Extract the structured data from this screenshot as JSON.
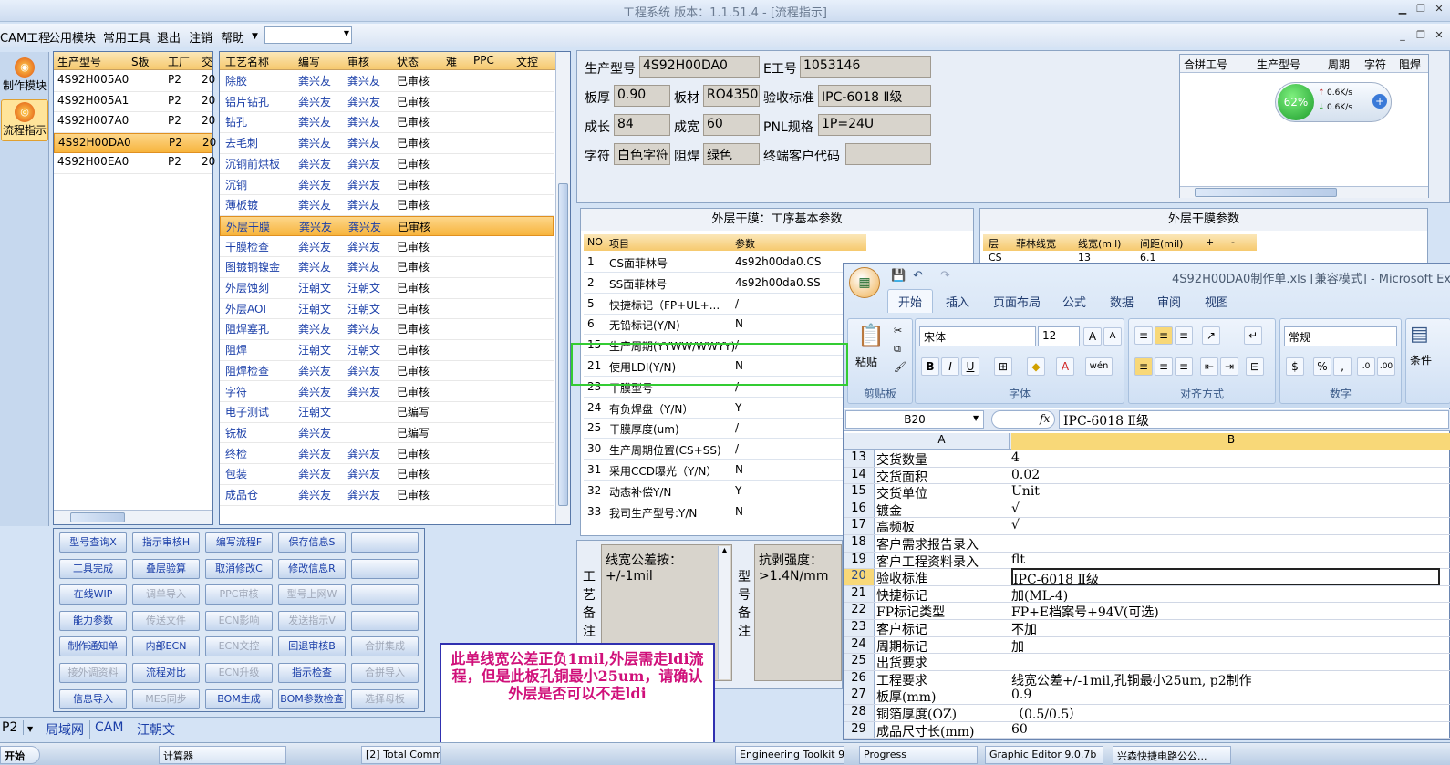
{
  "title": "工程系统   版本：1.1.51.4 - [流程指示]",
  "menu": [
    "CAM工程",
    "公用模块",
    "常用工具",
    "退出",
    "注销",
    "帮助"
  ],
  "nav": {
    "make": "制作模块",
    "flow": "流程指示"
  },
  "models": {
    "headers": [
      "生产型号",
      "S板",
      "工厂",
      "交"
    ],
    "rows": [
      [
        "4S92H005A0",
        "",
        "P2",
        "20"
      ],
      [
        "4S92H005A1",
        "",
        "P2",
        "20"
      ],
      [
        "4S92H007A0",
        "",
        "P2",
        "20"
      ],
      [
        "4S92H00DA0",
        "",
        "P2",
        "20"
      ],
      [
        "4S92H00EA0",
        "",
        "P2",
        "20"
      ]
    ],
    "selected_index": 3
  },
  "process": {
    "headers": [
      "工艺名称",
      "编写",
      "审核",
      "状态",
      "难",
      "PPC",
      "文控"
    ],
    "rows": [
      [
        "除胶",
        "龚兴友",
        "龚兴友",
        "已审核"
      ],
      [
        "铝片钻孔",
        "龚兴友",
        "龚兴友",
        "已审核"
      ],
      [
        "钻孔",
        "龚兴友",
        "龚兴友",
        "已审核"
      ],
      [
        "去毛刺",
        "龚兴友",
        "龚兴友",
        "已审核"
      ],
      [
        "沉铜前烘板",
        "龚兴友",
        "龚兴友",
        "已审核"
      ],
      [
        "沉铜",
        "龚兴友",
        "龚兴友",
        "已审核"
      ],
      [
        "薄板镀",
        "龚兴友",
        "龚兴友",
        "已审核"
      ],
      [
        "外层干膜",
        "龚兴友",
        "龚兴友",
        "已审核"
      ],
      [
        "干膜检查",
        "龚兴友",
        "龚兴友",
        "已审核"
      ],
      [
        "图镀铜镍金",
        "龚兴友",
        "龚兴友",
        "已审核"
      ],
      [
        "外层蚀刻",
        "汪朝文",
        "汪朝文",
        "已审核"
      ],
      [
        "外层AOI",
        "汪朝文",
        "汪朝文",
        "已审核"
      ],
      [
        "阻焊塞孔",
        "龚兴友",
        "龚兴友",
        "已审核"
      ],
      [
        "阻焊",
        "汪朝文",
        "汪朝文",
        "已审核"
      ],
      [
        "阻焊检查",
        "龚兴友",
        "龚兴友",
        "已审核"
      ],
      [
        "字符",
        "龚兴友",
        "龚兴友",
        "已审核"
      ],
      [
        "电子测试",
        "汪朝文",
        "",
        "已编写"
      ],
      [
        "铣板",
        "龚兴友",
        "",
        "已编写"
      ],
      [
        "终检",
        "龚兴友",
        "龚兴友",
        "已审核"
      ],
      [
        "包装",
        "龚兴友",
        "龚兴友",
        "已审核"
      ],
      [
        "成品仓",
        "龚兴友",
        "龚兴友",
        "已审核"
      ]
    ],
    "selected_index": 7
  },
  "buttons": [
    [
      "型号查询X",
      "指示审核H",
      "编写流程F",
      "保存信息S",
      ""
    ],
    [
      "工具完成",
      "叠层验算",
      "取消修改C",
      "修改信息R",
      ""
    ],
    [
      "在线WIP",
      "调单导入",
      "PPC审核",
      "型号上网W",
      ""
    ],
    [
      "能力参数",
      "传送文件",
      "ECN影响",
      "发送指示V",
      ""
    ],
    [
      "制作通知单",
      "内部ECN",
      "ECN文控",
      "回退审核B",
      "合拼集成"
    ],
    [
      "接外调资料",
      "流程对比",
      "ECN升级",
      "指示检查",
      "合拼导入"
    ],
    [
      "信息导入",
      "MES同步",
      "BOM生成",
      "BOM参数检查",
      "选择母板"
    ]
  ],
  "disabled_buttons": [
    "调单导入",
    "PPC审核",
    "型号上网W",
    "传送文件",
    "ECN影响",
    "发送指示V",
    "ECN文控",
    "合拼集成",
    "接外调资料",
    "ECN升级",
    "合拼导入",
    "MES同步",
    "选择母板"
  ],
  "status": {
    "combo": "P2",
    "items": [
      "局域网",
      "CAM",
      "汪朝文"
    ]
  },
  "info": {
    "model_label": "生产型号",
    "model": "4S92H00DA0",
    "eno_label": "E工号",
    "eno": "1053146",
    "thick_label": "板厚",
    "thick": "0.90",
    "mat_label": "板材",
    "mat": "RO4350B",
    "std_label": "验收标准",
    "std": "IPC-6018 Ⅱ级",
    "len_label": "成长",
    "len": "84",
    "wid_label": "成宽",
    "wid": "60",
    "pnl_label": "PNL规格",
    "pnl": "1P=24U",
    "char_label": "字符",
    "char": "白色字符",
    "mask_label": "阻焊",
    "mask": "绿色",
    "cust_label": "终端客户代码",
    "cust": ""
  },
  "merge": {
    "headers": [
      "合拼工号",
      "生产型号",
      "周期",
      "字符",
      "阻焊"
    ]
  },
  "net": {
    "percent": "62%",
    "up": "0.6K/s",
    "down": "0.6K/s"
  },
  "params": {
    "title": "外层干膜：工序基本参数",
    "headers": [
      "NO",
      "项目",
      "参数"
    ],
    "rows": [
      [
        "1",
        "CS面菲林号",
        "4s92h00da0.CS"
      ],
      [
        "2",
        "SS面菲林号",
        "4s92h00da0.SS"
      ],
      [
        "5",
        "快捷标记（FP+UL+...",
        "/"
      ],
      [
        "6",
        "无铅标记(Y/N)",
        "N"
      ],
      [
        "15",
        "生产周期(YYWW/WWYY)",
        "/"
      ],
      [
        "21",
        "使用LDI(Y/N)",
        "N"
      ],
      [
        "23",
        "干膜型号",
        "/"
      ],
      [
        "24",
        "有负焊盘（Y/N）",
        "Y"
      ],
      [
        "25",
        "干膜厚度(um)",
        "/"
      ],
      [
        "30",
        "生产周期位置(CS+SS)",
        "/"
      ],
      [
        "31",
        "采用CCD曝光（Y/N）",
        "N"
      ],
      [
        "32",
        "动态补偿Y/N",
        "Y"
      ],
      [
        "33",
        "我司生产型号:Y/N",
        "N"
      ]
    ]
  },
  "params2": {
    "title": "外层干膜参数",
    "headers": [
      "层",
      "菲林线宽",
      "线宽(mil)",
      "间距(mil)",
      "+",
      "-"
    ],
    "partial": [
      "CS",
      "",
      "13",
      "6.1"
    ]
  },
  "remarks": {
    "craft_label": "工艺备注",
    "craft": "线宽公差按：+/-1mil",
    "model_label": "型号备注",
    "model": "抗剥强度：>1.4N/mm"
  },
  "note": "此单线宽公差正负1mil,外层需走ldi流程，但是此板孔铜最小25um，请确认外层是否可以不走ldi",
  "excel": {
    "title": "4S92H00DA0制作单.xls [兼容模式] - Microsoft Excel",
    "tabs": [
      "开始",
      "插入",
      "页面布局",
      "公式",
      "数据",
      "审阅",
      "视图"
    ],
    "font": "宋体",
    "size": "12",
    "numfmt": "常规",
    "groups": [
      "剪贴板",
      "字体",
      "对齐方式",
      "数字"
    ],
    "paste": "粘贴",
    "cond": "条件",
    "namebox": "B20",
    "fx": "fx",
    "formula": "IPC-6018 Ⅱ级",
    "colA": "A",
    "colB": "B",
    "rows": [
      [
        "13",
        "交货数量",
        "4"
      ],
      [
        "14",
        "交货面积",
        "0.02"
      ],
      [
        "15",
        "交货单位",
        "Unit"
      ],
      [
        "16",
        "镀金",
        "√"
      ],
      [
        "17",
        "高频板",
        "√"
      ],
      [
        "18",
        "客户需求报告录入",
        ""
      ],
      [
        "19",
        "客户工程资料录入",
        "flt"
      ],
      [
        "20",
        "验收标准",
        "IPC-6018 Ⅱ级"
      ],
      [
        "21",
        "快捷标记",
        "加(ML-4)"
      ],
      [
        "22",
        "FP标记类型",
        "FP+E档案号+94V(可选)"
      ],
      [
        "23",
        "客户标记",
        "不加"
      ],
      [
        "24",
        "周期标记",
        "加"
      ],
      [
        "25",
        "出货要求",
        ""
      ],
      [
        "26",
        "工程要求",
        "线宽公差+/-1mil,孔铜最小25um, p2制作"
      ],
      [
        "27",
        "板厚(mm)",
        "0.9"
      ],
      [
        "28",
        "铜箔厚度(OZ)",
        "（0.5/0.5）"
      ],
      [
        "29",
        "成品尺寸长(mm)",
        "60"
      ]
    ],
    "highlight_row": "20"
  },
  "taskbar": [
    "开始",
    "计算器",
    "[2] Total Comm...",
    "Engineering Toolkit 9...",
    "Progress",
    "Graphic Editor 9.0.7b",
    "兴森快捷电路公公..."
  ]
}
